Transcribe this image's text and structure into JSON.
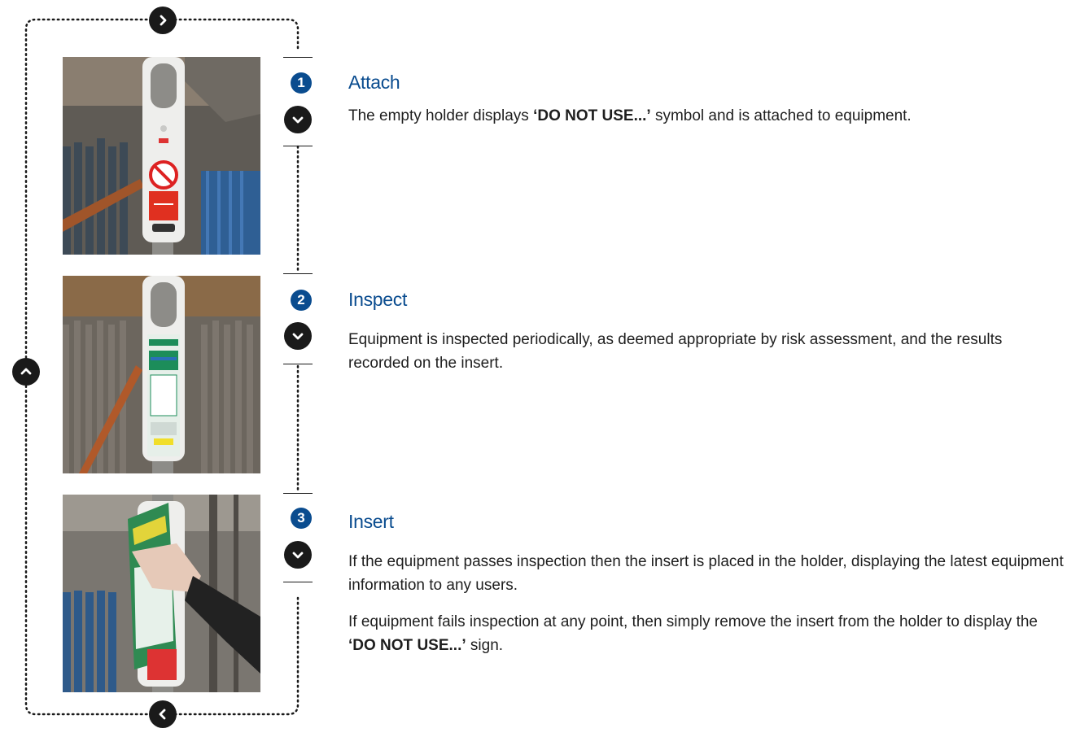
{
  "loop_controls": {
    "top": "chevron-right-icon",
    "left": "chevron-up-icon",
    "bottom": "chevron-left-icon"
  },
  "steps": [
    {
      "number": "1",
      "title": "Attach",
      "photo": "scafftag-holder-empty",
      "text_before": "The empty holder displays ",
      "text_strong": "‘DO NOT USE...’",
      "text_after": " symbol and is attached to equipment."
    },
    {
      "number": "2",
      "title": "Inspect",
      "photo": "scafftag-holder-with-insert",
      "text": "Equipment is inspected periodically, as deemed appropriate by risk assessment, and the results recorded on the insert."
    },
    {
      "number": "3",
      "title": "Insert",
      "photo": "hand-placing-insert",
      "text": "If the equipment passes inspection then the insert is placed in the holder, displaying the latest equipment information to any users.",
      "text2_before": "If equipment fails inspection at any point, then simply remove the insert from the holder to display the ",
      "text2_strong": "‘DO NOT USE...’",
      "text2_after": " sign."
    }
  ],
  "colors": {
    "accent": "#0a4c8f",
    "dark": "#1a1a1a"
  }
}
